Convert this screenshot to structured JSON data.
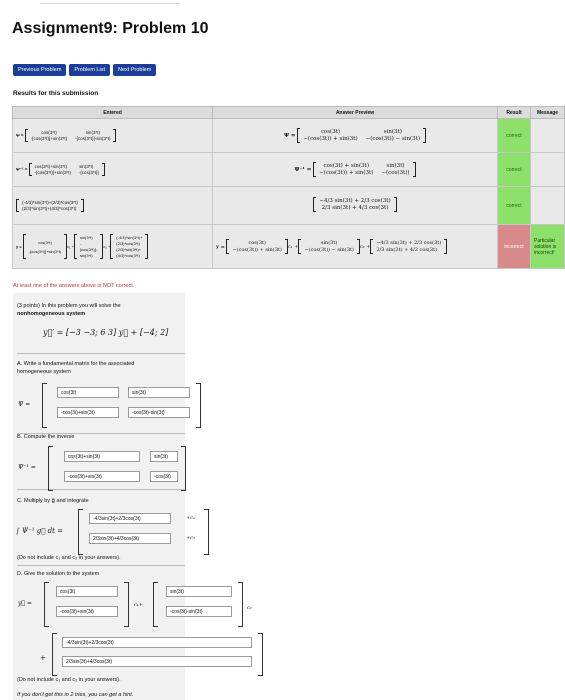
{
  "header": {
    "title": "Assignment9: Problem 10"
  },
  "nav": {
    "prev": "Previous Problem",
    "list": "Problem List",
    "next": "Next Problem"
  },
  "results": {
    "heading": "Results for this submission",
    "columns": {
      "entered": "Entered",
      "preview": "Answer Preview",
      "result": "Result",
      "message": "Message"
    },
    "rows": [
      {
        "entered_lhs": "Ψ =",
        "entered": [
          "cos(3*t)",
          "sin(3*t)",
          "-[cos(3*t)]+sin(3*t)",
          "-[cos(3*t)]-sin(3*t)"
        ],
        "preview_lhs": "Ψ =",
        "preview": [
          "cos(3t)",
          "sin(3t)",
          "−(cos(3t)) + sin(3t)",
          "−(cos(3t)) − sin(3t)"
        ],
        "result": "correct",
        "message": ""
      },
      {
        "entered_lhs": "Ψ⁻¹ =",
        "entered": [
          "cos(3*t)+sin(3*t)",
          "sin(3*t)",
          "-[cos(3*t)]+sin(3*t)",
          "-[cos(3*t)]"
        ],
        "preview_lhs": "Ψ⁻¹ =",
        "preview": [
          "cos(3t) + sin(3t)",
          "sin(3t)",
          "−(cos(3t)) + sin(3t)",
          "−(cos(3t))"
        ],
        "result": "correct",
        "message": ""
      },
      {
        "entered_lhs": "",
        "entered": [
          "(-4/3)*sin(3*t)+(2/3)*cos(3*t)",
          "(2/3)*sin(3*t)+(4/3)*cos(3*t)"
        ],
        "preview_lhs": "",
        "preview": [
          "−4/3 sin(3t) + 2/3 cos(3t)",
          "2/3 sin(3t) + 4/3 cos(3t)"
        ],
        "result": "correct",
        "message": ""
      },
      {
        "entered_lhs": "y =",
        "entered": [
          "cos(3*t)",
          "-[cos(3*t)]+sin(3*t)",
          "c₁ +",
          "sin(3*t)",
          "-",
          "[cos(3*t)]-",
          "sin(3*t)",
          "c₂ +",
          "(-4/3)*sin(3*t)+",
          "(2/3)*cos(3*t)",
          "(2/3)*sin(3*t)+",
          "(4/3)*cos(3*t)"
        ],
        "preview_lhs": "y =",
        "preview": [
          "cos(3t)",
          "−(cos(3t)) + sin(3t)",
          "c₁ +",
          "sin(3t)",
          "−(cos(3t)) − sin(3t)",
          "c₂ +",
          "−4/3 sin(3t) + 2/3 cos(3t)",
          "2/3 sin(3t) + 4/3 cos(3t)"
        ],
        "result": "incorrect",
        "message": "Particular solution is incorrect!"
      }
    ],
    "note": "At least one of the answers above is NOT correct."
  },
  "problem": {
    "intro1": "(3 points) In this problem you will solve the",
    "intro2": "nonhomogeneous system",
    "system": "y⃗′ = [−3 −3; 6 3] y⃗ + [−4; 2]",
    "A_label": "A. Write a fundamental matrix for the associated",
    "A_label2": "homogeneous system",
    "A_lhs": "Ψ =",
    "A_answers": [
      "cos(3t)",
      "sin(3t)",
      "-cos(3t)+sin(3t)",
      "-cos(3t)-sin(3t)"
    ],
    "B_label": "B. Compute the inverse",
    "B_lhs": "Ψ⁻¹ =",
    "B_answers": [
      "cos(3t)+sin(3t)",
      "sin(3t)",
      "-cos(3t)+sin(3t)",
      "-cos(3t)"
    ],
    "C_label": "C. Multiply by g⃗ and integrate",
    "C_lhs": "∫ Ψ⁻¹ g⃗ dt =",
    "C_answers": [
      "-4/3sin(3t)+2/3cos(3t)",
      "2/3sin(3t)+4/3cos(3t)"
    ],
    "C_c1": "+c₁",
    "C_c2": "+c₂",
    "C_note": "(Do not include c₁ and c₂ in your answers).",
    "D_label": "D. Give the solution to the system",
    "D_lhs": "y⃗ =",
    "D_answers": [
      "cos(3t)",
      "-cos(3t)+sin(3t)",
      "sin(3t)",
      "-cos(3t)-sin(3t)",
      "-4/3sin(3t)+2/3cos(3t)",
      "2/3sin(3t)+4/3cos(3t)"
    ],
    "D_c1": "c₁+",
    "D_c2": "c₂",
    "D_plus": "+",
    "D_note": "(Do not include c₁ and c₂ in your answers).",
    "footer": "If you don't get this in 2 tries, you can get a hint."
  },
  "colors": {
    "nav": "#1b3f99",
    "correct": "#8de06a",
    "incorrect": "#d98b8b",
    "error_text": "#cc3333"
  }
}
